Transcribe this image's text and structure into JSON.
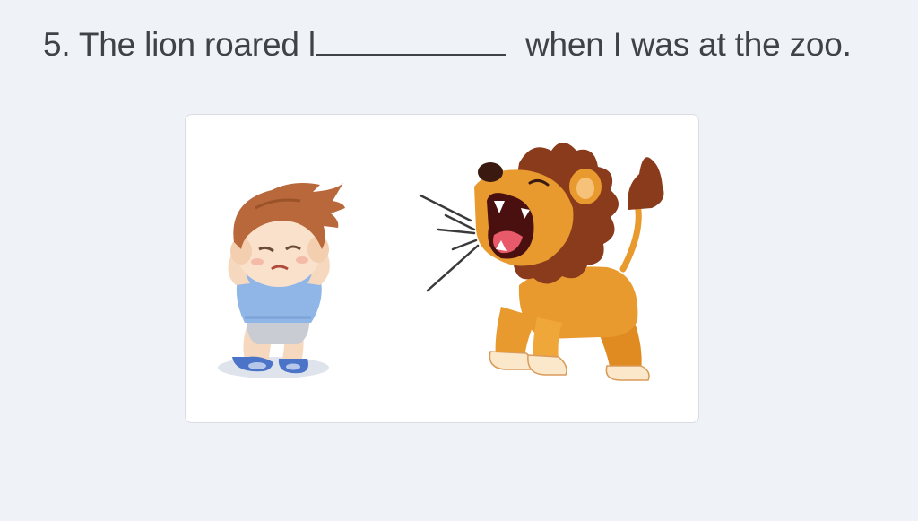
{
  "question": {
    "number": "5.",
    "text_before": "The lion roared l",
    "text_after": "when I was at the zoo."
  },
  "illustration": {
    "items": [
      "scared-boy-covering-ears",
      "roaring-lion"
    ]
  },
  "colors": {
    "background": "#eff2f6",
    "card": "#ffffff",
    "text": "#3f4247",
    "lion_body": "#e89a2e",
    "lion_mane": "#8a3b1b",
    "boy_hair": "#b8683a",
    "boy_shirt": "#8fb6e6"
  }
}
